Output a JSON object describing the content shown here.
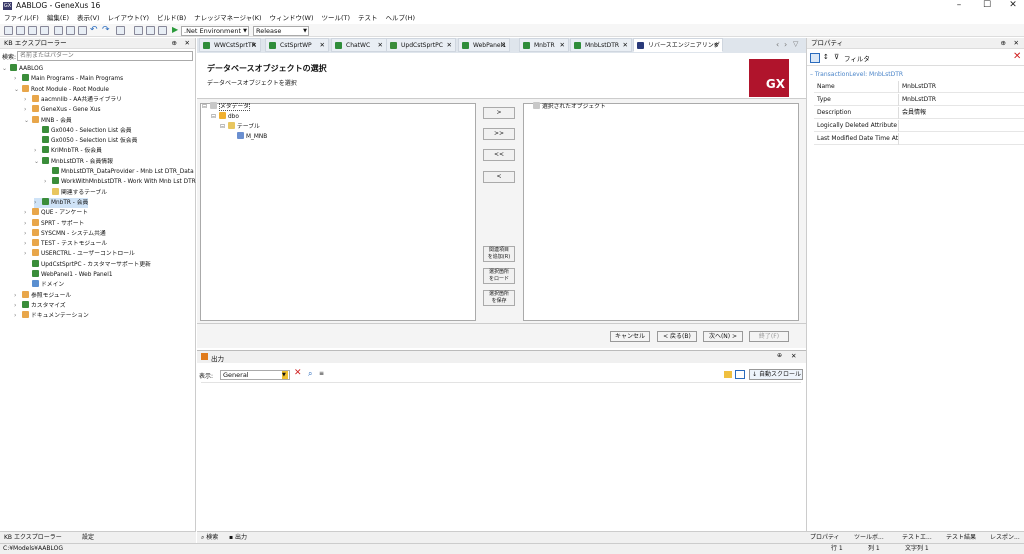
{
  "window": {
    "title": "AABLOG - GeneXus 16",
    "logo": "GX"
  },
  "menu": [
    "ファイル(F)",
    "編集(E)",
    "表示(V)",
    "レイアウト(Y)",
    "ビルド(B)",
    "ナレッジマネージャ(K)",
    "ウィンドウ(W)",
    "ツール(T)",
    "テスト",
    "ヘルプ(H)"
  ],
  "toolbar": {
    "environment": ".Net Environment",
    "config": "Release"
  },
  "kb_explorer": {
    "title": "KB エクスプローラー",
    "search_label": "検索:",
    "search_placeholder": "名前またはパターン",
    "items": [
      {
        "label": "AABLOG"
      },
      {
        "label": "Main Programs - Main Programs"
      },
      {
        "label": "Root Module - Root Module"
      },
      {
        "label": "aacmnlib - AA共通ライブラリ"
      },
      {
        "label": "GeneXus - Gene Xus"
      },
      {
        "label": "MNB - 会員"
      },
      {
        "label": "Gx0040 - Selection List 会員"
      },
      {
        "label": "Gx0050 - Selection List 仮会員"
      },
      {
        "label": "KriMnbTR - 仮会員"
      },
      {
        "label": "MnbLstDTR - 会員情報"
      },
      {
        "label": "MnbLstDTR_DataProvider - Mnb Lst DTR_Data"
      },
      {
        "label": "WorkWithMnbLstDTR - Work With Mnb Lst DTR"
      },
      {
        "label": "関連するテーブル"
      },
      {
        "label": "MnbTR - 会員"
      },
      {
        "label": "QUE - アンケート"
      },
      {
        "label": "SPRT - サポート"
      },
      {
        "label": "SYSCMN - システム共通"
      },
      {
        "label": "TEST - テストモジュール"
      },
      {
        "label": "USERCTRL - ユーザーコントロール"
      },
      {
        "label": "UpdCstSprtPC - カスタマーサポート更新"
      },
      {
        "label": "WebPanel1 - Web Panel1"
      },
      {
        "label": "ドメイン"
      },
      {
        "label": "参照モジュール"
      },
      {
        "label": "カスタマイズ"
      },
      {
        "label": "ドキュメンテーション"
      }
    ],
    "bottom_tabs": [
      "KB エクスプローラー",
      "設定"
    ]
  },
  "tabs": [
    "WWCstSprtTR",
    "CstSprtWP",
    "ChatWC",
    "UpdCstSprtPC",
    "WebPanel1",
    "MnbTR",
    "MnbLstDTR",
    "リバースエンジニアリング"
  ],
  "wizard": {
    "title": "データベースオブジェクトの選択",
    "subtitle": "データベースオブジェクトを選択",
    "badge": "GX",
    "left_tree": [
      "メタデータ",
      "dbo",
      "テーブル",
      "M_MNB"
    ],
    "right_title": "選択されたオブジェクト",
    "move_buttons": [
      ">",
      ">>",
      "<<",
      "<"
    ],
    "action_buttons": [
      [
        "関連項目",
        "を追加(R)"
      ],
      [
        "選択箇所",
        "をロード"
      ],
      [
        "選択箇所",
        "を保存"
      ]
    ],
    "nav": {
      "cancel": "キャンセル",
      "back": "< 戻る(B)",
      "next": "次へ(N) >",
      "finish": "終了(F)"
    }
  },
  "output": {
    "title": "出力",
    "show_label": "表示:",
    "show_value": "General",
    "autoscroll": "自動スクロール",
    "bottom_tabs": [
      "検索",
      "出力"
    ]
  },
  "properties": {
    "title": "プロパティ",
    "filter": "フィルタ",
    "section": "TransactionLevel: MnbLstDTR",
    "rows": [
      {
        "k": "Name",
        "v": "MnbLstDTR"
      },
      {
        "k": "Type",
        "v": "MnbLstDTR"
      },
      {
        "k": "Description",
        "v": "会員情報"
      },
      {
        "k": "Logically Deleted Attribute",
        "v": ""
      },
      {
        "k": "Last Modified Date Time At",
        "v": ""
      }
    ],
    "bottom_tabs": [
      "プロパティ",
      "ツールボ...",
      "テストエ...",
      "テスト結果",
      "レスポン..."
    ]
  },
  "status": {
    "path": "C:¥Models¥AABLOG",
    "row": "行 1",
    "col": "列 1",
    "char": "文字列 1"
  }
}
